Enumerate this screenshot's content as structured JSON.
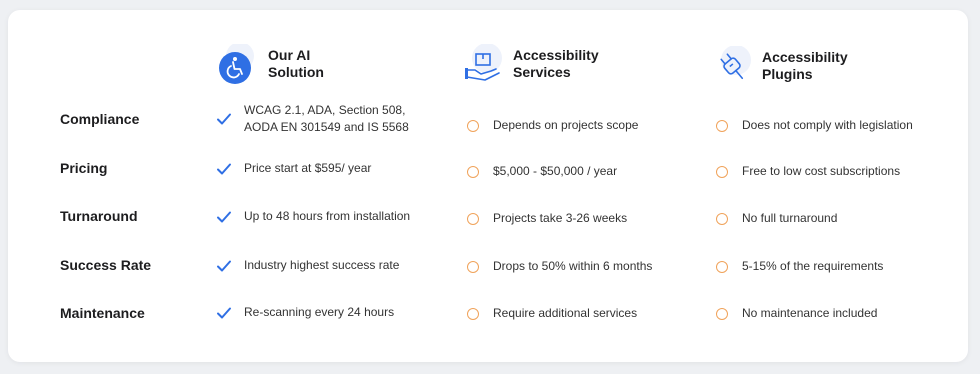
{
  "columns": [
    {
      "title": "Our AI\nSolution",
      "icon": "wheelchair-accessibility-icon"
    },
    {
      "title": "Accessibility\nServices",
      "icon": "hand-holding-box-icon"
    },
    {
      "title": "Accessibility\nPlugins",
      "icon": "plug-icon"
    }
  ],
  "rows": [
    {
      "label": "Compliance",
      "values": [
        "WCAG 2.1, ADA, Section 508,\nAODA EN 301549 and IS 5568",
        "Depends on projects scope",
        "Does not comply with legislation"
      ]
    },
    {
      "label": "Pricing",
      "values": [
        " Price start at $595/ year",
        "$5,000 - $50,000 / year",
        "Free to low cost subscriptions"
      ]
    },
    {
      "label": "Turnaround",
      "values": [
        "Up to 48 hours from installation",
        "Projects take 3-26 weeks",
        "No full turnaround"
      ]
    },
    {
      "label": "Success Rate",
      "values": [
        "Industry highest success rate",
        "Drops to 50% within 6 months",
        "5-15% of the requirements"
      ]
    },
    {
      "label": "Maintenance",
      "values": [
        "Re-scanning every 24 hours",
        "Require additional services",
        "No maintenance included"
      ]
    }
  ],
  "colors": {
    "check": "#2f6fe4",
    "circle": "#f0a35b",
    "accent": "#2f6fe4"
  }
}
